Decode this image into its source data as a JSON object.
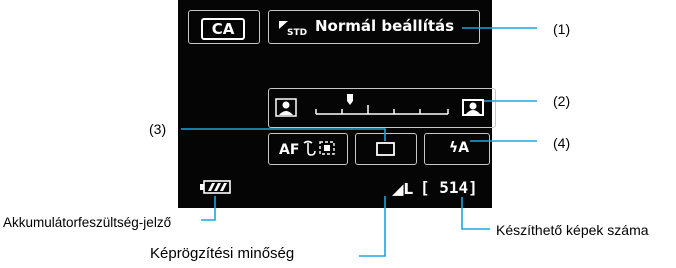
{
  "screen": {
    "shooting_mode": "CA",
    "ambience_icon": "STD",
    "ambience_label": "Normál beállítás",
    "af_label": "AF",
    "flash_label": "ϟA",
    "quality_label": "◢L",
    "shots_remaining": "[ 514]",
    "battery_icon": "battery-icon",
    "drive_icon": "single-shooting-icon",
    "blur_icons": [
      "background-blur-icon",
      "background-sharp-icon"
    ]
  },
  "callouts": {
    "c1": "(1)",
    "c2": "(2)",
    "c3": "(3)",
    "c4": "(4)",
    "battery": "Akkumulátorfeszültség-jelző",
    "quality": "Képrögzítési minőség",
    "shots": "Készíthető képek száma"
  },
  "colors": {
    "screen_bg": "#050505",
    "leader_line": "#1aa7e0",
    "box_border": "#c7c7c7"
  }
}
